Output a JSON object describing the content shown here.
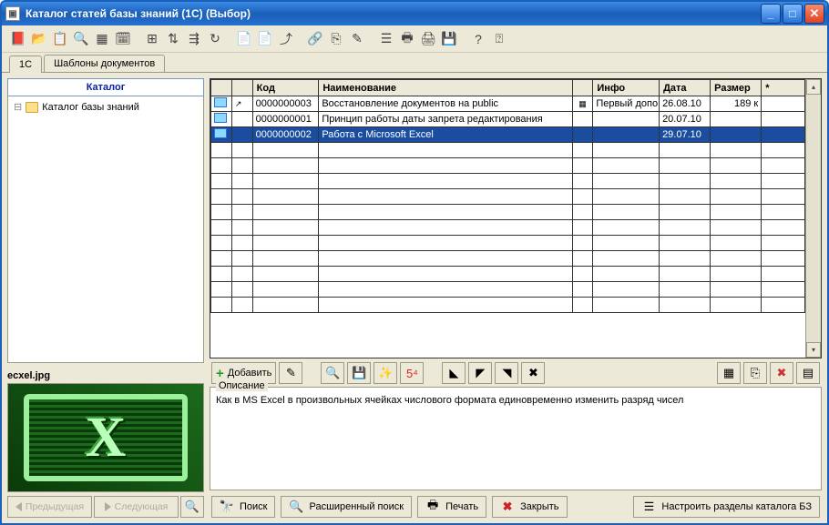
{
  "window": {
    "title": "Каталог статей базы знаний (1C) (Выбор)"
  },
  "tabs": {
    "t1": "1С",
    "t2": "Шаблоны документов"
  },
  "sidebar": {
    "header": "Каталог",
    "root_item": "Каталог базы знаний",
    "file_label": "ecxel.jpg",
    "prev_btn": "Предыдущая",
    "next_btn": "Следующая"
  },
  "grid": {
    "headers": {
      "code": "Код",
      "name": "Наименование",
      "info": "Инфо",
      "date": "Дата",
      "size": "Размер",
      "star": "*"
    },
    "rows": [
      {
        "code": "0000000003",
        "name": "Восстановление документов на public",
        "info": "Первый допо",
        "date": "26.08.10",
        "size": "189 к"
      },
      {
        "code": "0000000001",
        "name": "Принцип работы даты запрета редактирования",
        "info": "",
        "date": "20.07.10",
        "size": ""
      },
      {
        "code": "0000000002",
        "name": "Работа с Microsoft Excel",
        "info": "",
        "date": "29.07.10",
        "size": ""
      }
    ]
  },
  "mid_toolbar": {
    "add": "Добавить"
  },
  "description": {
    "legend": "Описание",
    "text": "Как в MS Excel в произвольных ячейках числового формата единовременно изменить разряд чисел"
  },
  "bottom": {
    "search": "Поиск",
    "adv_search": "Расширенный поиск",
    "print": "Печать",
    "close": "Закрыть",
    "config": "Настроить разделы каталога БЗ"
  }
}
